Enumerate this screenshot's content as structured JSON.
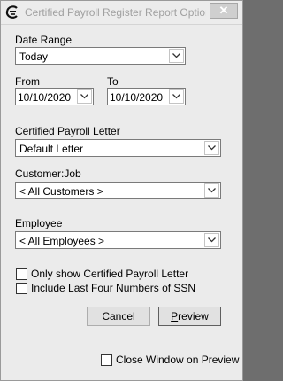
{
  "window": {
    "title": "Certified Payroll Register Report Options",
    "app_icon": "c-logo-icon",
    "close_glyph": "✕"
  },
  "date_range": {
    "label": "Date Range",
    "value": "Today"
  },
  "from": {
    "label": "From",
    "value": "10/10/2020"
  },
  "to": {
    "label": "To",
    "value": "10/10/2020"
  },
  "payroll_letter": {
    "label": "Certified Payroll Letter",
    "value": "Default Letter"
  },
  "customer_job": {
    "label": "Customer:Job",
    "value": "< All Customers >"
  },
  "employee": {
    "label": "Employee",
    "value": "< All Employees >"
  },
  "options": {
    "only_letter": {
      "label": "Only show Certified Payroll Letter",
      "checked": false
    },
    "last_four_ssn": {
      "label": "Include Last Four Numbers of SSN",
      "checked": false
    },
    "close_on_preview": {
      "label": "Close Window on Preview",
      "checked": false
    }
  },
  "buttons": {
    "cancel": "Cancel",
    "preview_first": "P",
    "preview_rest": "review"
  }
}
